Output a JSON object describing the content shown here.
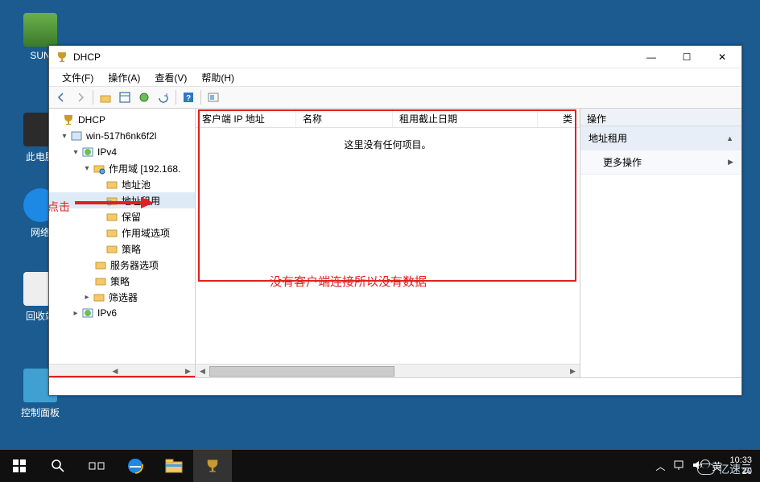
{
  "desktop": {
    "icons": {
      "sun": "SUN",
      "this_pc": "此电脑",
      "network": "网络",
      "recycle": "回收站",
      "control_panel": "控制面板"
    }
  },
  "window": {
    "title": "DHCP",
    "wbtn": {
      "min": "—",
      "max": "☐",
      "close": "✕"
    },
    "menu": {
      "file": "文件(F)",
      "action": "操作(A)",
      "view": "查看(V)",
      "help": "帮助(H)"
    },
    "tree": {
      "root": "DHCP",
      "server": "win-517h6nk6f2l",
      "ipv4": "IPv4",
      "scope": "作用域 [192.168.",
      "pool": "地址池",
      "leases": "地址租用",
      "reservations": "保留",
      "scope_options": "作用域选项",
      "policies": "策略",
      "server_options": "服务器选项",
      "policies2": "策略",
      "filters": "筛选器",
      "ipv6": "IPv6"
    },
    "annotations": {
      "click": "点击",
      "nodata": "没有客户端连接所以没有数据"
    },
    "list": {
      "columns": {
        "ip": "客户端 IP 地址",
        "name": "名称",
        "expire": "租用截止日期",
        "type": "类"
      },
      "empty": "这里没有任何项目。"
    },
    "actions": {
      "header": "操作",
      "row1": "地址租用",
      "row2": "更多操作"
    }
  },
  "tray": {
    "ime": "英",
    "time": "10:33",
    "date_trunc": "20"
  },
  "watermark": "亿速云"
}
